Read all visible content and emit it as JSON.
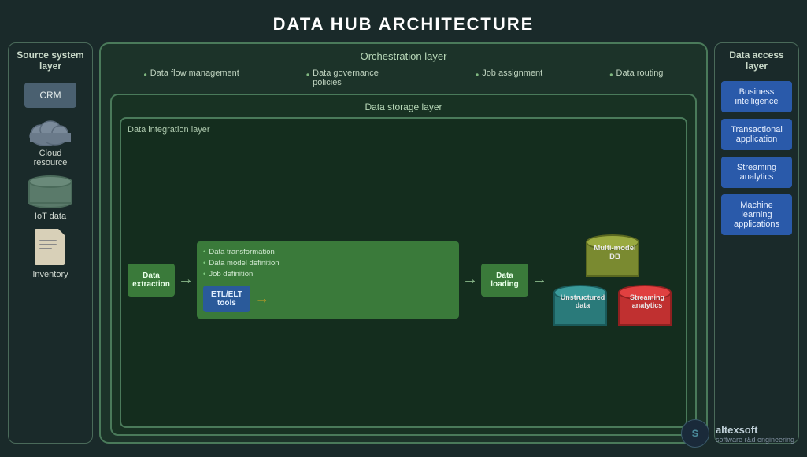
{
  "title": "DATA HUB ARCHITECTURE",
  "source_layer": {
    "title": "Source\nsystem layer",
    "items": [
      {
        "label": "CRM",
        "type": "crm"
      },
      {
        "label": "Cloud\nresource",
        "type": "cloud"
      },
      {
        "label": "IoT data",
        "type": "cylinder"
      },
      {
        "label": "Inventory",
        "type": "doc"
      }
    ]
  },
  "orchestration_layer": {
    "title": "Orchestration layer",
    "items": [
      {
        "bullet": "•",
        "text": "Data flow management"
      },
      {
        "bullet": "•",
        "text": "Data governance policies"
      },
      {
        "bullet": "•",
        "text": "Job assignment"
      },
      {
        "bullet": "•",
        "text": "Data routing"
      }
    ]
  },
  "data_storage_layer": {
    "title": "Data storage layer"
  },
  "data_integration_layer": {
    "title": "Data integration layer",
    "extraction_label": "Data\nextraction",
    "arrow1": "→",
    "transformation_items": [
      "Data transformation",
      "Data model definition",
      "Job definition"
    ],
    "etl_label": "ETL/ELT\ntools",
    "arrow2": "→",
    "loading_label": "Data\nloading",
    "arrow3": "→"
  },
  "databases": {
    "multimodel": {
      "label": "Multi-model\nDB"
    },
    "unstructured": {
      "label": "Unstructured\ndata"
    },
    "streaming": {
      "label": "Streaming\nanalytics"
    }
  },
  "access_layer": {
    "title": "Data access\nlayer",
    "items": [
      "Business\nintelligence",
      "Transactional\napplication",
      "Streaming\nanalytics",
      "Machine\nlearning\napplications"
    ]
  },
  "logo": {
    "symbol": "s",
    "name": "altexsoft",
    "tagline": "software r&d engineering"
  }
}
